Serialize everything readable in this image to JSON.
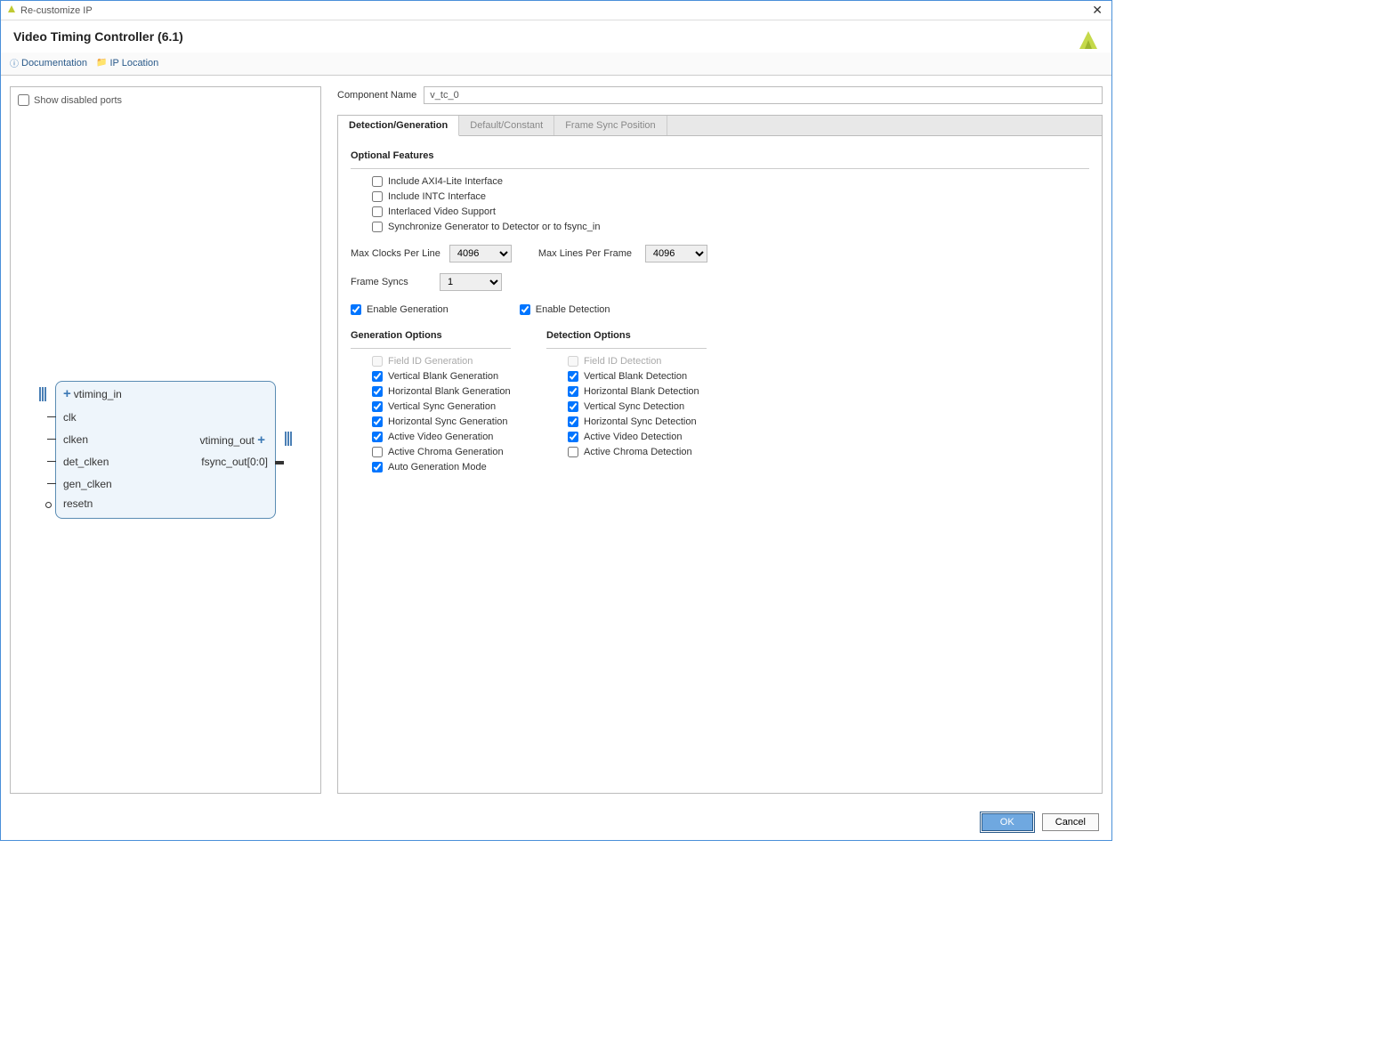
{
  "window": {
    "title": "Re-customize IP",
    "close": "✕"
  },
  "header": {
    "ipTitle": "Video Timing Controller (6.1)"
  },
  "toolbar": {
    "doc": "Documentation",
    "loc": "IP Location"
  },
  "left": {
    "showDisabled": "Show disabled ports",
    "ports": {
      "vtiming_in": "vtiming_in",
      "clk": "clk",
      "clken": "clken",
      "det_clken": "det_clken",
      "gen_clken": "gen_clken",
      "resetn": "resetn",
      "vtiming_out": "vtiming_out",
      "fsync_out": "fsync_out[0:0]"
    }
  },
  "right": {
    "compLabel": "Component Name",
    "compValue": "v_tc_0",
    "tabs": [
      "Detection/Generation",
      "Default/Constant",
      "Frame Sync Position"
    ],
    "optFeat": "Optional Features",
    "cb": {
      "axi": "Include AXI4-Lite Interface",
      "intc": "Include INTC Interface",
      "interlaced": "Interlaced Video Support",
      "sync": "Synchronize Generator to Detector or to fsync_in"
    },
    "sel": {
      "maxClocks": "Max Clocks Per Line",
      "maxClocksVal": "4096",
      "maxLines": "Max Lines Per Frame",
      "maxLinesVal": "4096",
      "frameSyncs": "Frame Syncs",
      "frameSyncsVal": "1"
    },
    "enableGen": "Enable Generation",
    "enableDet": "Enable Detection",
    "genTitle": "Generation Options",
    "detTitle": "Detection Options",
    "gen": {
      "fieldId": "Field ID Generation",
      "vblank": "Vertical Blank Generation",
      "hblank": "Horizontal Blank Generation",
      "vsync": "Vertical Sync Generation",
      "hsync": "Horizontal Sync Generation",
      "avideo": "Active Video Generation",
      "achroma": "Active Chroma Generation",
      "auto": "Auto Generation Mode"
    },
    "det": {
      "fieldId": "Field ID Detection",
      "vblank": "Vertical Blank Detection",
      "hblank": "Horizontal Blank Detection",
      "vsync": "Vertical Sync Detection",
      "hsync": "Horizontal Sync Detection",
      "avideo": "Active Video Detection",
      "achroma": "Active Chroma Detection"
    }
  },
  "footer": {
    "ok": "OK",
    "cancel": "Cancel"
  }
}
